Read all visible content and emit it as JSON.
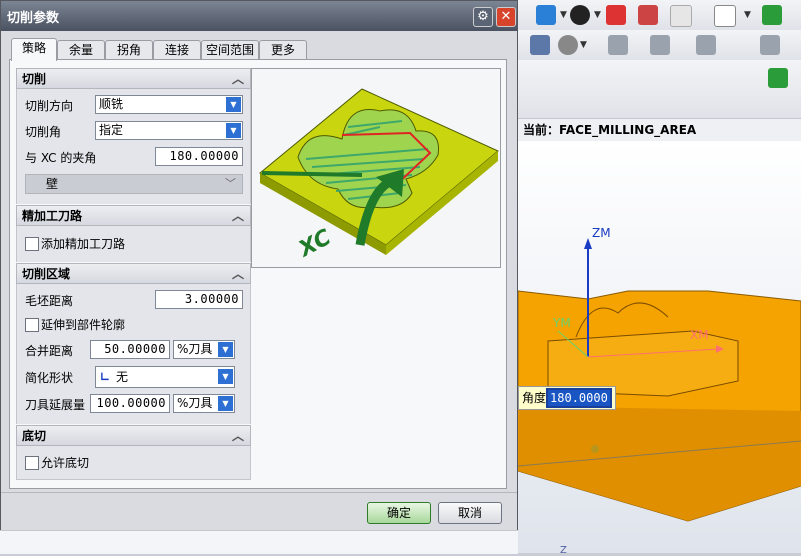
{
  "dialog": {
    "title": "切削参数",
    "tabs": [
      "策略",
      "余量",
      "拐角",
      "连接",
      "空间范围",
      "更多"
    ],
    "active_tab": "策略"
  },
  "cutting": {
    "header": "切削",
    "direction_label": "切削方向",
    "direction_value": "顺铣",
    "angle_label": "切削角",
    "angle_value": "指定",
    "xc_angle_label": "与 XC 的夹角",
    "xc_angle_value": "180.00000",
    "wall_label": "壁"
  },
  "finish": {
    "header": "精加工刀路",
    "add_finish_label": "添加精加工刀路",
    "add_finish_checked": false
  },
  "region": {
    "header": "切削区域",
    "blank_distance_label": "毛坯距离",
    "blank_distance_value": "3.00000",
    "extend_label": "延伸到部件轮廓",
    "extend_checked": false,
    "merge_distance_label": "合并距离",
    "merge_distance_value": "50.00000",
    "merge_unit": "%刀具",
    "simplify_label": "简化形状",
    "simplify_value": "无",
    "tool_extend_label": "刀具延展量",
    "tool_extend_value": "100.00000",
    "tool_extend_unit": "%刀具"
  },
  "undercut": {
    "header": "底切",
    "allow_label": "允许底切",
    "allow_checked": false
  },
  "preview": {
    "label": "XC"
  },
  "buttons": {
    "ok": "确定",
    "cancel": "取消"
  },
  "background": {
    "current_label": "当前：FACE_MILLING_AREA",
    "axis_z": "ZM",
    "axis_y": "YM",
    "axis_x": "XM",
    "angle_tip_label": "角度",
    "angle_tip_value": "180.0000",
    "bottom_char": "Z"
  },
  "colors": {
    "accent_blue": "#2e6fd4",
    "ok_green": "#a8d89b",
    "model_orange": "#f5a300",
    "close_red": "#d8432c"
  }
}
